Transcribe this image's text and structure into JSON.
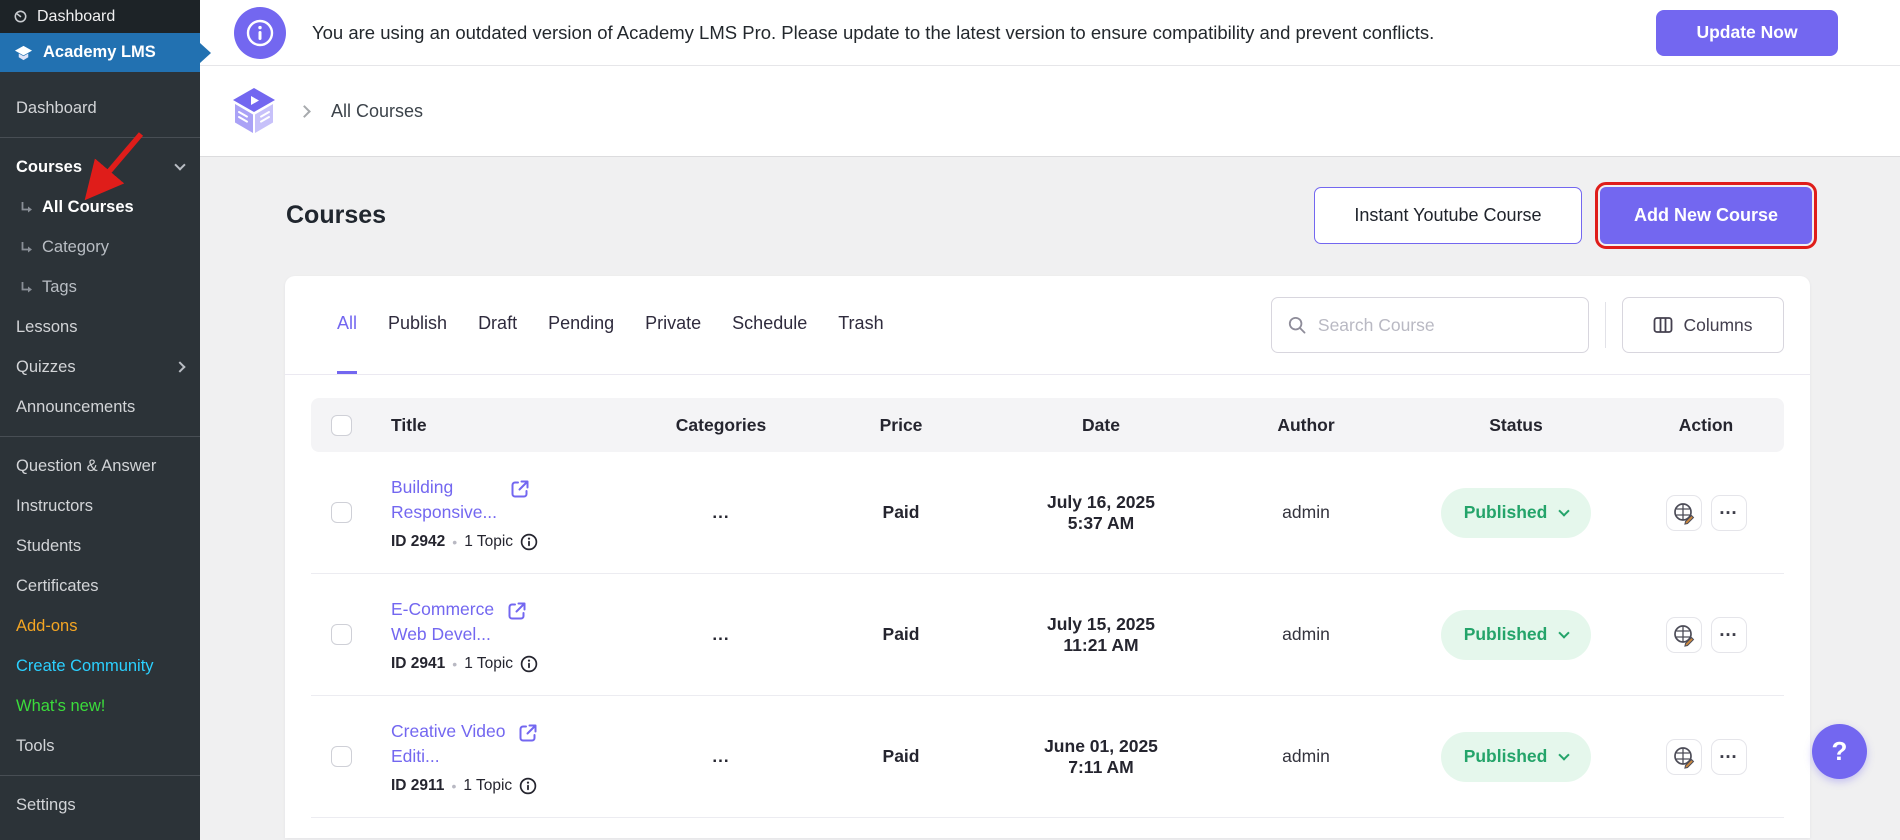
{
  "admin_bar": {
    "dashboard_label": "Dashboard"
  },
  "sidebar": {
    "app_label": "Academy LMS",
    "items": [
      {
        "label": "Dashboard"
      },
      {
        "label": "Courses",
        "chevron": "down",
        "bold": true
      },
      {
        "label": "All Courses",
        "submenu": true,
        "bold": true
      },
      {
        "label": "Category",
        "submenu": true
      },
      {
        "label": "Tags",
        "submenu": true
      },
      {
        "label": "Lessons"
      },
      {
        "label": "Quizzes",
        "chevron": "right"
      },
      {
        "label": "Announcements"
      },
      {
        "label": "Question & Answer"
      },
      {
        "label": "Instructors"
      },
      {
        "label": "Students"
      },
      {
        "label": "Certificates"
      },
      {
        "label": "Add-ons",
        "color": "#f5a623"
      },
      {
        "label": "Create Community",
        "color": "#2bd0ff"
      },
      {
        "label": "What's new!",
        "color": "#3bdc3b"
      },
      {
        "label": "Tools"
      },
      {
        "label": "Settings"
      }
    ]
  },
  "banner": {
    "message": "You are using an outdated version of Academy LMS Pro. Please update to the latest version to ensure compatibility and prevent conflicts.",
    "button_label": "Update Now"
  },
  "breadcrumb": {
    "current": "All Courses"
  },
  "page": {
    "title": "Courses",
    "instant_button_label": "Instant Youtube Course",
    "add_button_label": "Add New Course"
  },
  "tabs": {
    "active": "All",
    "items": [
      "All",
      "Publish",
      "Draft",
      "Pending",
      "Private",
      "Schedule",
      "Trash"
    ]
  },
  "toolbar": {
    "search_placeholder": "Search Course",
    "columns_label": "Columns"
  },
  "table": {
    "headers": [
      "Title",
      "Categories",
      "Price",
      "Date",
      "Author",
      "Status",
      "Action"
    ],
    "separator": "•",
    "more_glyph": "…",
    "rows": [
      {
        "title_line1": "Building",
        "title_line2": "Responsive...",
        "id": "ID 2942",
        "topics": "1 Topic",
        "categories": "...",
        "price": "Paid",
        "date_line1": "July 16, 2025",
        "date_line2": "5:37 AM",
        "author": "admin",
        "status": "Published"
      },
      {
        "title_line1": "E-Commerce",
        "title_line2": "Web Devel...",
        "id": "ID 2941",
        "topics": "1 Topic",
        "categories": "...",
        "price": "Paid",
        "date_line1": "July 15, 2025",
        "date_line2": "11:21 AM",
        "author": "admin",
        "status": "Published"
      },
      {
        "title_line1": "Creative Video",
        "title_line2": "Editi...",
        "id": "ID 2911",
        "topics": "1 Topic",
        "categories": "...",
        "price": "Paid",
        "date_line1": "June 01, 2025",
        "date_line2": "7:11 AM",
        "author": "admin",
        "status": "Published"
      }
    ]
  },
  "help": {
    "label": "?"
  },
  "colors": {
    "accent_purple": "#7367f0",
    "wp_active_blue": "#2271b1",
    "published_green": "#24a46a",
    "annotation_red": "#df1d1a",
    "addons_orange": "#f5a623",
    "community_cyan": "#2bd0ff",
    "whatsnew_green": "#3bdc3b"
  }
}
